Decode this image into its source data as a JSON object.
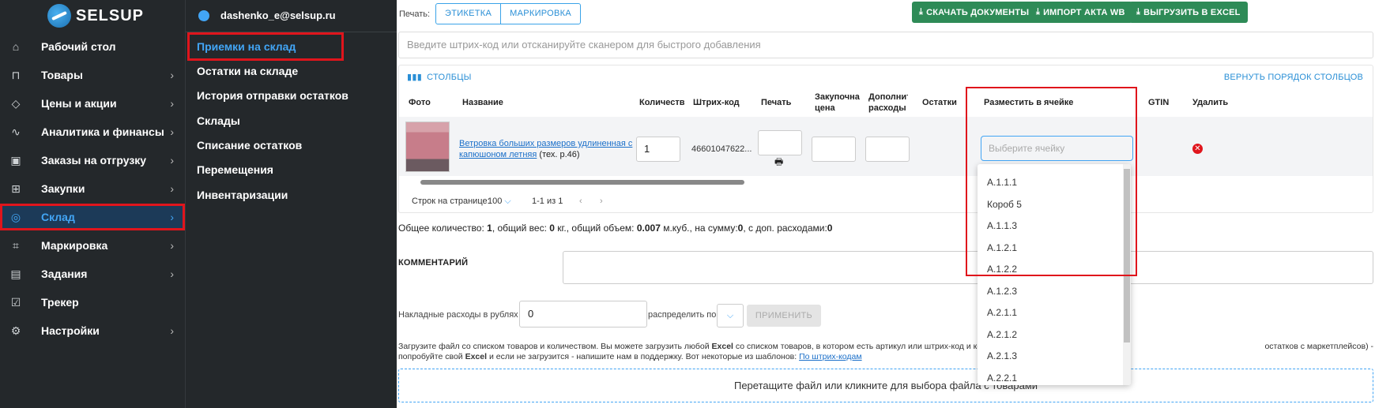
{
  "sidebar": {
    "logo": "SELSUP",
    "items": [
      {
        "label": "Рабочий стол",
        "icon": "home-icon",
        "glyph": "⌂",
        "chevron": false
      },
      {
        "label": "Товары",
        "icon": "bag-icon",
        "glyph": "⊓",
        "chevron": true
      },
      {
        "label": "Цены и акции",
        "icon": "tag-icon",
        "glyph": "◇",
        "chevron": true
      },
      {
        "label": "Аналитика и финансы",
        "icon": "chart-icon",
        "glyph": "∿",
        "chevron": true
      },
      {
        "label": "Заказы на отгрузку",
        "icon": "box-icon",
        "glyph": "▣",
        "chevron": true
      },
      {
        "label": "Закупки",
        "icon": "cart-icon",
        "glyph": "⊞",
        "chevron": true
      },
      {
        "label": "Склад",
        "icon": "warehouse-icon",
        "glyph": "◎",
        "chevron": true,
        "active": true
      },
      {
        "label": "Маркировка",
        "icon": "scan-icon",
        "glyph": "⌗",
        "chevron": true
      },
      {
        "label": "Задания",
        "icon": "tasks-icon",
        "glyph": "▤",
        "chevron": true
      },
      {
        "label": "Трекер",
        "icon": "tracker-icon",
        "glyph": "☑",
        "chevron": false
      },
      {
        "label": "Настройки",
        "icon": "gear-icon",
        "glyph": "⚙",
        "chevron": true
      }
    ]
  },
  "user": {
    "email": "dashenko_e@selsup.ru"
  },
  "submenu": [
    {
      "label": "Приемки на склад",
      "active": true
    },
    {
      "label": "Остатки на складе"
    },
    {
      "label": "История отправки остатков"
    },
    {
      "label": "Склады"
    },
    {
      "label": "Списание остатков"
    },
    {
      "label": "Перемещения"
    },
    {
      "label": "Инвентаризации"
    }
  ],
  "toolbar": {
    "print_label": "Печать:",
    "print_options": [
      "ЭТИКЕТКА",
      "МАРКИРОВКА"
    ],
    "btn_download": "СКАЧАТЬ ДОКУМЕНТЫ",
    "btn_import": "ИМПОРТ АКТА WB",
    "btn_export": "ВЫГРУЗИТЬ В EXCEL"
  },
  "barcode_placeholder": "Введите штрих-код или отсканируйте сканером для быстрого добавления",
  "table": {
    "columns_btn": "СТОЛБЦЫ",
    "reset_btn": "ВЕРНУТЬ ПОРЯДОК СТОЛБЦОВ",
    "headers": {
      "photo": "Фото",
      "name": "Название",
      "qty": "Количеств",
      "barcode": "Штрих-код",
      "print": "Печать",
      "price": "Закупочна цена",
      "extra": "Дополнит расходы",
      "stock": "Остатки",
      "cell": "Разместить в ячейке",
      "gtin": "GTIN",
      "delete": "Удалить"
    },
    "row": {
      "name_link": "Ветровка больших размеров удлиненная с капюшоном летняя",
      "name_suffix": " (тех. р.46)",
      "qty": "1",
      "barcode": "46601047622...",
      "cell_placeholder": "Выберите ячейку"
    },
    "pager": {
      "rows_label": "Строк на странице:",
      "rows_value": "100",
      "range": "1-1 из 1"
    }
  },
  "dropdown_options": [
    "А.1.1.1",
    "Короб 5",
    "А.1.1.3",
    "А.1.2.1",
    "А.1.2.2",
    "А.1.2.3",
    "А.2.1.1",
    "А.2.1.2",
    "А.2.1.3",
    "А.2.2.1"
  ],
  "summary": {
    "t1": "Общее количество: ",
    "v1": "1",
    "t2": ", общий вес: ",
    "v2": "0",
    "t3": " кг., общий объем: ",
    "v3": "0.007",
    "t4": " м.куб., на сумму:",
    "v4": "0",
    "t5": ", с доп. расходами:",
    "v5": "0"
  },
  "comment_label": "КОММЕНТАРИЙ",
  "overhead": {
    "label": "Накладные расходы в рублях",
    "value": "0",
    "distribute_label": "распределить по",
    "apply_btn": "ПРИМЕНИТЬ"
  },
  "help": {
    "line1a": "Загрузите файл со списком товаров и количеством. Вы можете загрузить любой ",
    "line1b": "Excel",
    "line1c": " со списком товаров, в котором есть артикул или штрих-код и количество, поддерживает",
    "line1d": "остатков с маркетплейсов) -",
    "line2a": "попробуйте свой ",
    "line2b": "Excel",
    "line2c": " и если не загрузится - напишите нам в поддержку. Вот некоторые из шаблонов: ",
    "link": "По штрих-кодам"
  },
  "dropzone": "Перетащите файл или кликните для выбора файла с товарами",
  "colors": {
    "accent": "#42a5f5",
    "sidebar": "#24282b",
    "green": "#2e8b57",
    "highlight": "#e0151c"
  }
}
